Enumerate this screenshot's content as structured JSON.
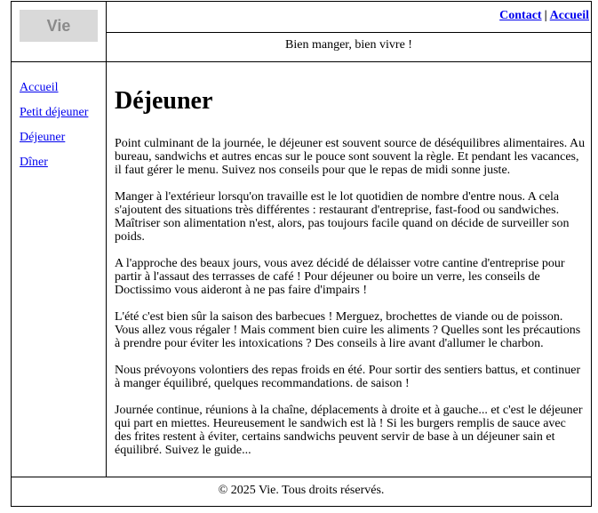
{
  "site": {
    "logo": "Vie",
    "slogan": "Bien manger, bien vivre !"
  },
  "topnav": {
    "contact": "Contact",
    "separator": "|",
    "home": "Accueil"
  },
  "sidenav": [
    "Accueil",
    "Petit déjeuner",
    "Déjeuner",
    "Dîner"
  ],
  "main": {
    "title": "Déjeuner",
    "paragraphs": [
      "Point culminant de la journée, le déjeuner est souvent source de déséquilibres alimentaires. Au bureau, sandwichs et autres encas sur le pouce sont souvent la règle. Et pendant les vacances, il faut gérer le menu. Suivez nos conseils pour que le repas de midi sonne juste.",
      "Manger à l'extérieur lorsqu'on travaille est le lot quotidien de nombre d'entre nous. A cela s'ajoutent des situations très différentes : restaurant d'entreprise, fast-food ou sandwiches. Maîtriser son alimentation n'est, alors, pas toujours facile quand on décide de surveiller son poids.",
      "A l'approche des beaux jours, vous avez décidé de délaisser votre cantine d'entreprise pour partir à l'assaut des terrasses de café ! Pour déjeuner ou boire un verre, les conseils de Doctissimo vous aideront à ne pas faire d'impairs !",
      "L'été c'est bien sûr la saison des barbecues ! Merguez, brochettes de viande ou de poisson. Vous allez vous régaler ! Mais comment bien cuire les aliments ? Quelles sont les précautions à prendre pour éviter les intoxications ? Des conseils à lire avant d'allumer le charbon.",
      "Nous prévoyons volontiers des repas froids en été. Pour sortir des sentiers battus, et continuer à manger équilibré, quelques recommandations. de saison !",
      "Journée continue, réunions à la chaîne, déplacements à droite et à gauche... et c'est le déjeuner qui part en miettes. Heureusement le sandwich est là ! Si les burgers remplis de sauce avec des frites restent à éviter, certains sandwichs peuvent servir de base à un déjeuner sain et équilibré. Suivez le guide..."
    ]
  },
  "footer": {
    "text": "© 2025 Vie. Tous droits réservés."
  }
}
